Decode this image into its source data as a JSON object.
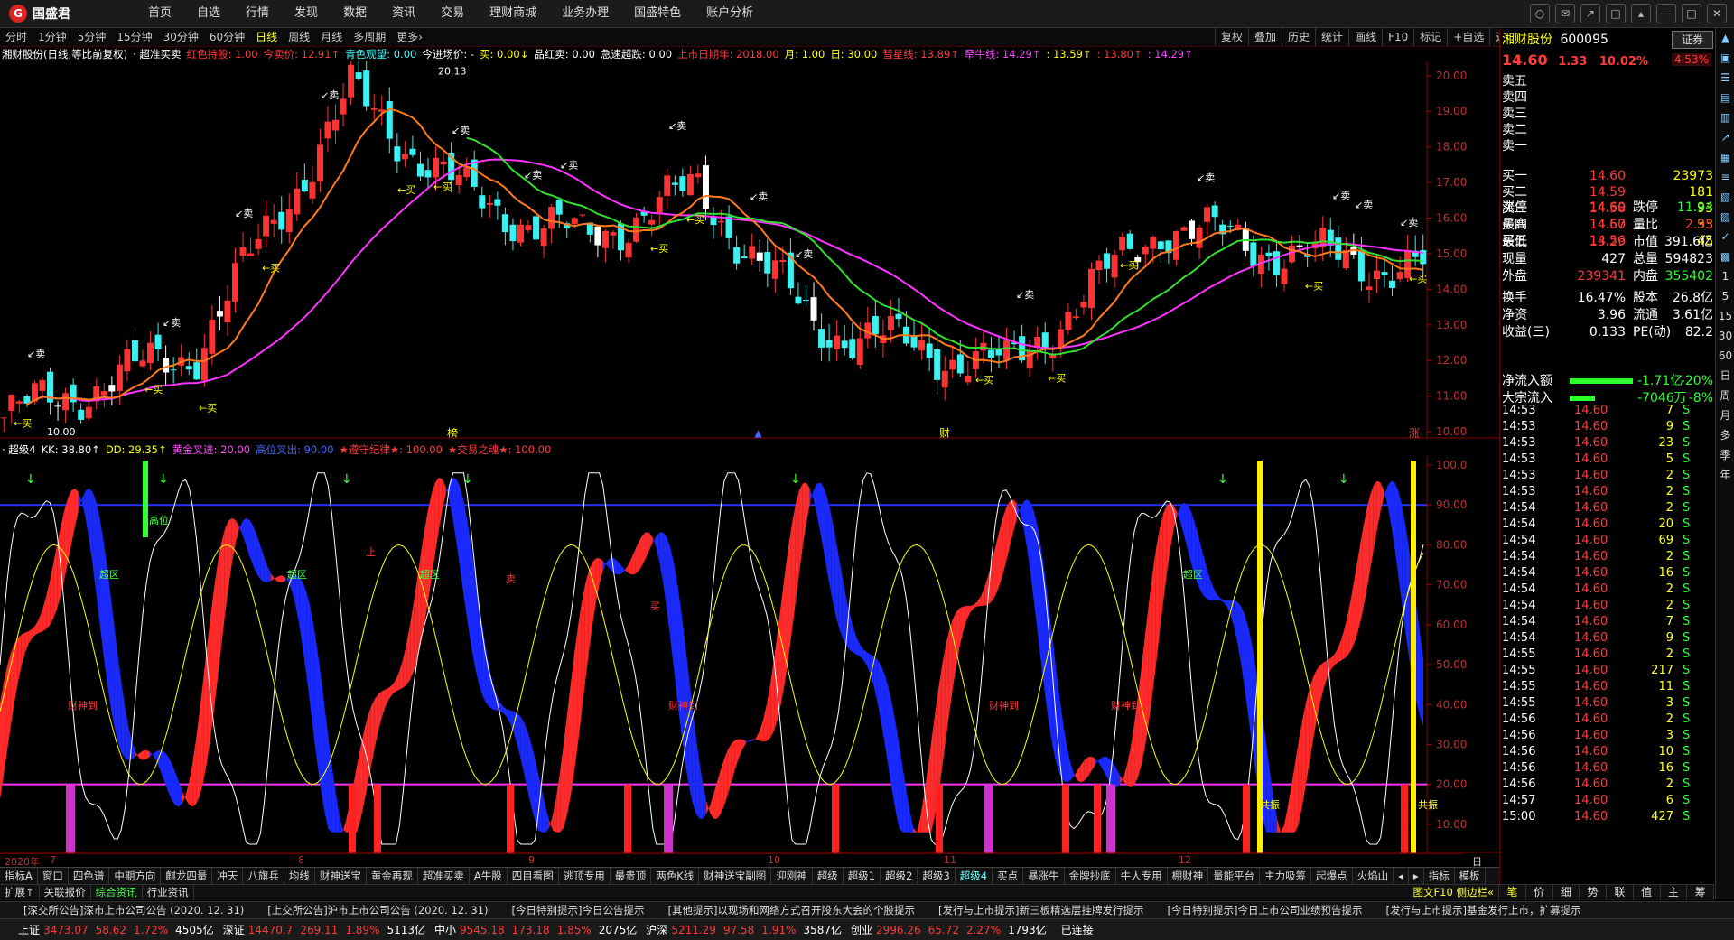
{
  "app": {
    "logo_text": "国盛君"
  },
  "nav": [
    "首页",
    "自选",
    "行情",
    "发现",
    "数据",
    "资讯",
    "交易",
    "理财商城",
    "业务办理",
    "国盛特色",
    "账户分析"
  ],
  "window_controls": [
    "○",
    "✉",
    "↗",
    "□",
    "▴",
    "—",
    "□",
    "✕"
  ],
  "periods": [
    "分时",
    "1分钟",
    "5分钟",
    "15分钟",
    "30分钟",
    "60分钟",
    "日线",
    "周线",
    "月线",
    "多周期",
    "更多›"
  ],
  "active_period": "日线",
  "tools": [
    "复权",
    "叠加",
    "历史",
    "统计",
    "画线",
    "F10",
    "标记",
    "+自选",
    "返回"
  ],
  "info_line": {
    "stock": "湘财股份(日线,等比前复权)",
    "items": [
      {
        "text": "· 超准买卖",
        "color": "#ffffff"
      },
      {
        "text": "红色持股: 1.00",
        "color": "#ff3b3b"
      },
      {
        "text": "今卖价: 12.91↑",
        "color": "#ff3b3b"
      },
      {
        "text": "青色观望: 0.00",
        "color": "#4ff"
      },
      {
        "text": "今进场价: -",
        "color": "#ffffff"
      },
      {
        "text": "买: 0.00↓",
        "color": "#ffff00"
      },
      {
        "text": "品红卖: 0.00",
        "color": "#ffffff"
      },
      {
        "text": "急速超跌: 0.00",
        "color": "#ffffff"
      },
      {
        "text": "上市日期年: 2018.00",
        "color": "#ff3b3b"
      },
      {
        "text": "月: 1.00",
        "color": "#ffff00"
      },
      {
        "text": "日: 30.00",
        "color": "#ffff00"
      },
      {
        "text": "彗星线: 13.89↑",
        "color": "#ff3b3b"
      },
      {
        "text": "牵牛线: 14.29↑",
        "color": "#f4f"
      },
      {
        "text": ": 13.59↑",
        "color": "#ffff00"
      },
      {
        "text": ": 13.80↑",
        "color": "#ff3b3b"
      },
      {
        "text": ": 14.29↑",
        "color": "#f4f"
      }
    ]
  },
  "price_axis": [
    "20.00",
    "19.00",
    "18.00",
    "17.00",
    "16.00",
    "15.00",
    "14.00",
    "13.00",
    "12.00",
    "11.00",
    "10.00"
  ],
  "price_notes": {
    "high": "20.13",
    "low": "10.00"
  },
  "event_labels": [
    {
      "text": "榜",
      "color": "#ffff00"
    },
    {
      "text": "▲",
      "color": "#4466ff"
    },
    {
      "text": "财",
      "color": "#ffff00"
    },
    {
      "text": "涨",
      "color": "#ff3b3b"
    }
  ],
  "indicator_line": {
    "name": "· 超级4",
    "items": [
      {
        "text": "KK: 38.80↑",
        "color": "#ffffff"
      },
      {
        "text": "DD: 29.35↑",
        "color": "#ffff00"
      },
      {
        "text": "黄金叉进: 20.00",
        "color": "#f4f"
      },
      {
        "text": "高位叉出: 90.00",
        "color": "#4466ff"
      },
      {
        "text": "★遵守纪律★: 100.00",
        "color": "#ff3b3b"
      },
      {
        "text": "★交易之魂★: 100.00",
        "color": "#ff3b3b"
      }
    ]
  },
  "ind_axis": [
    "100.0",
    "90.00",
    "80.00",
    "70.00",
    "60.00",
    "50.00",
    "40.00",
    "30.00",
    "20.00",
    "10.00"
  ],
  "ind_labels": [
    {
      "text": "高位",
      "color": "#4f4"
    },
    {
      "text": "超区",
      "color": "#4f4"
    },
    {
      "text": "超区",
      "color": "#4f4"
    },
    {
      "text": "超区",
      "color": "#4f4"
    },
    {
      "text": "超区",
      "color": "#4f4"
    },
    {
      "text": "财神到",
      "color": "#ff3b3b"
    },
    {
      "text": "财神到",
      "color": "#ff3b3b"
    },
    {
      "text": "财神到",
      "color": "#ff3b3b"
    },
    {
      "text": "财神到",
      "color": "#ff3b3b"
    },
    {
      "text": "共振",
      "color": "#ffff00"
    },
    {
      "text": "共振",
      "color": "#ffff00"
    },
    {
      "text": "止",
      "color": "#ff3b3b"
    },
    {
      "text": "卖",
      "color": "#ff3b3b"
    },
    {
      "text": "买",
      "color": "#ff3b3b"
    }
  ],
  "x_axis": [
    "2020年",
    "7",
    "8",
    "9",
    "10",
    "11",
    "12",
    "日线"
  ],
  "tabs1": [
    "指标A",
    "窗口",
    "四色谱",
    "中期方向",
    "麒龙四量",
    "冲天",
    "八旗兵",
    "均线",
    "财神送宝",
    "黄金再现",
    "超准买卖",
    "A牛股",
    "四目看图",
    "逃顶专用",
    "最贵顶",
    "两色K线",
    "财神送宝副图",
    "迎刚神",
    "超级",
    "超级1",
    "超级2",
    "超级3",
    "超级4",
    "买点",
    "暴涨牛",
    "金牌抄底",
    "牛人专用",
    "棚财神",
    "量能平台",
    "主力吸筹",
    "起爆点",
    "火焰山",
    "◂",
    "▸",
    "指标",
    "模板"
  ],
  "active_tab1": "超级4",
  "tabs2": [
    "扩展↑",
    "关联报价",
    "综合资讯",
    "行业资讯"
  ],
  "tabs2_right": "图文F10 侧边栏«",
  "news": [
    "[深交所公告]深市上市公司公告 (2020. 12. 31)",
    "[上交所公告]沪市上市公司公告 (2020. 12. 31)",
    "[今日特别提示]今日公告提示",
    "[其他提示]以现场和网络方式召开股东大会的个股提示",
    "[发行与上市提示]新三板精选层挂牌发行提示",
    "[今日特别提示]今日上市公司业绩预告提示",
    "[发行与上市提示]基金发行上市，扩募提示"
  ],
  "status": [
    {
      "label": "上证",
      "val": "3473.07",
      "chg": "58.62",
      "pct": "1.72%",
      "amt": "4505亿"
    },
    {
      "label": "深证",
      "val": "14470.7",
      "chg": "269.11",
      "pct": "1.89%",
      "amt": "5113亿"
    },
    {
      "label": "中小",
      "val": "9545.18",
      "chg": "173.18",
      "pct": "1.85%",
      "amt": "2075亿"
    },
    {
      "label": "沪深",
      "val": "5211.29",
      "chg": "97.58",
      "pct": "1.91%",
      "amt": "3587亿"
    },
    {
      "label": "创业",
      "val": "2996.26",
      "chg": "65.72",
      "pct": "2.27%",
      "amt": "1793亿"
    }
  ],
  "connection": "已连接",
  "quote": {
    "name": "湘财股份",
    "code": "600095",
    "tag": "证券",
    "tag_pct": "4.53%",
    "price": "14.60",
    "change": "1.33",
    "pct": "10.02%",
    "sell": [
      "卖五",
      "卖四",
      "卖三",
      "卖二",
      "卖一"
    ],
    "buy": [
      {
        "label": "买一",
        "price": "14.60",
        "vol": "23973"
      },
      {
        "label": "买二",
        "price": "14.59",
        "vol": "181"
      },
      {
        "label": "买三",
        "price": "14.58",
        "vol": "93"
      },
      {
        "label": "买四",
        "price": "14.57",
        "vol": "33"
      },
      {
        "label": "买五",
        "price": "14.56",
        "vol": "45"
      }
    ],
    "stats": [
      {
        "l1": "涨停",
        "v1": "14.60",
        "c1": "#ff3b3b",
        "l2": "跌停",
        "v2": "11.94",
        "c2": "#2cff2c"
      },
      {
        "l1": "最高",
        "v1": "14.60",
        "c1": "#ff3b3b",
        "l2": "量比",
        "v2": "2.95",
        "c2": "#ff3b3b"
      },
      {
        "l1": "最低",
        "v1": "13.29",
        "c1": "#ff3b3b",
        "l2": "市值",
        "v2": "391.6亿",
        "c2": "#ffffff"
      },
      {
        "l1": "现量",
        "v1": "427",
        "c1": "#ffffff",
        "l2": "总量",
        "v2": "594823",
        "c2": "#ffffff"
      },
      {
        "l1": "外盘",
        "v1": "239341",
        "c1": "#ff3b3b",
        "l2": "内盘",
        "v2": "355402",
        "c2": "#2cff2c"
      },
      {
        "l1": "换手",
        "v1": "16.47%",
        "c1": "#ffffff",
        "l2": "股本",
        "v2": "26.8亿",
        "c2": "#ffffff"
      },
      {
        "l1": "净资",
        "v1": "3.96",
        "c1": "#ffffff",
        "l2": "流通",
        "v2": "3.61亿",
        "c2": "#ffffff"
      },
      {
        "l1": "收益(三)",
        "v1": "0.133",
        "c1": "#ffffff",
        "l2": "PE(动)",
        "v2": "82.2",
        "c2": "#ffffff"
      }
    ],
    "flows": [
      {
        "label": "净流入额",
        "val": "-1.71亿",
        "pct": "-20%"
      },
      {
        "label": "大宗流入",
        "val": "-7046万",
        "pct": "-8%"
      }
    ],
    "ticks": [
      [
        "14:53",
        "14.60",
        "7",
        "S"
      ],
      [
        "14:53",
        "14.60",
        "9",
        "S"
      ],
      [
        "14:53",
        "14.60",
        "23",
        "S"
      ],
      [
        "14:53",
        "14.60",
        "5",
        "S"
      ],
      [
        "14:53",
        "14.60",
        "2",
        "S"
      ],
      [
        "14:53",
        "14.60",
        "2",
        "S"
      ],
      [
        "14:54",
        "14.60",
        "2",
        "S"
      ],
      [
        "14:54",
        "14.60",
        "20",
        "S"
      ],
      [
        "14:54",
        "14.60",
        "69",
        "S"
      ],
      [
        "14:54",
        "14.60",
        "2",
        "S"
      ],
      [
        "14:54",
        "14.60",
        "16",
        "S"
      ],
      [
        "14:54",
        "14.60",
        "2",
        "S"
      ],
      [
        "14:54",
        "14.60",
        "2",
        "S"
      ],
      [
        "14:54",
        "14.60",
        "7",
        "S"
      ],
      [
        "14:54",
        "14.60",
        "9",
        "S"
      ],
      [
        "14:55",
        "14.60",
        "2",
        "S"
      ],
      [
        "14:55",
        "14.60",
        "217",
        "S"
      ],
      [
        "14:55",
        "14.60",
        "11",
        "S"
      ],
      [
        "14:55",
        "14.60",
        "3",
        "S"
      ],
      [
        "14:56",
        "14.60",
        "2",
        "S"
      ],
      [
        "14:56",
        "14.60",
        "3",
        "S"
      ],
      [
        "14:56",
        "14.60",
        "10",
        "S"
      ],
      [
        "14:56",
        "14.60",
        "16",
        "S"
      ],
      [
        "14:56",
        "14.60",
        "2",
        "S"
      ],
      [
        "14:57",
        "14.60",
        "6",
        "S"
      ],
      [
        "15:00",
        "14.60",
        "427",
        "S"
      ]
    ]
  },
  "rbottom": [
    "笔",
    "价",
    "细",
    "势",
    "联",
    "值",
    "主",
    "筹"
  ],
  "rsidebar": [
    "▲",
    "▣",
    "☰",
    "▤",
    "▥",
    "↗",
    "▦",
    "≡",
    "▧",
    "▨",
    "✓",
    "▩",
    "▪",
    "▫",
    "▬",
    "▭",
    "▮",
    "▯",
    "▰",
    "▱",
    "▲",
    "△",
    "▴",
    "▵"
  ],
  "rsidebar_text": [
    "1",
    "5",
    "15",
    "30",
    "60",
    "日",
    "周",
    "月",
    "多",
    "季",
    "年"
  ]
}
